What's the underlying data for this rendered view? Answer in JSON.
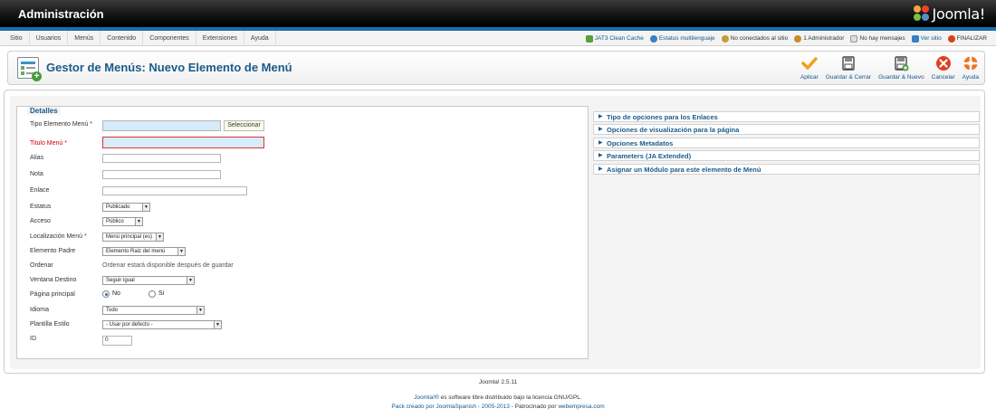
{
  "header": {
    "title": "Administración",
    "logo_text": "Joomla!"
  },
  "menubar": {
    "items": [
      "Sitio",
      "Usuarios",
      "Menús",
      "Contenido",
      "Componentes",
      "Extensiones",
      "Ayuda"
    ],
    "status": {
      "clean_cache": "JAT3 Clean Cache",
      "multilang": "Estatus multilenguaje",
      "site_visitors": "No conectados al sitio",
      "admins": "1 Administrador",
      "messages": "No hay mensajes",
      "view_site": "Ver sitio",
      "logout": "FINALIZAR"
    }
  },
  "toolbar": {
    "title": "Gestor de Menús: Nuevo Elemento de Menú",
    "buttons": {
      "apply": "Aplicar",
      "save_close": "Guardar & Cerrar",
      "save_new": "Guardar & Nuevo",
      "cancel": "Cancelar",
      "help": "Ayuda"
    }
  },
  "form": {
    "legend": "Detalles",
    "menu_type_label": "Tipo Elemento Menú",
    "select_button": "Seleccionar",
    "title_label": "Titulo Menú",
    "alias_label": "Alias",
    "note_label": "Nota",
    "link_label": "Enlace",
    "status_label": "Estatus",
    "status_value": "Publicado",
    "access_label": "Acceso",
    "access_value": "Público",
    "location_label": "Localización Menú",
    "location_value": "Menú principal (es)",
    "parent_label": "Elemento Padre",
    "parent_value": "Elemento Raiz del menú",
    "order_label": "Ordenar",
    "order_text": "Ordenar estará disponible después de guardar",
    "target_label": "Ventana Destino",
    "target_value": "Seguir igual",
    "home_label": "Página principal",
    "home_no": "No",
    "home_yes": "Si",
    "language_label": "Idioma",
    "language_value": "Todo",
    "template_label": "Plantilla Estilo",
    "template_value": "- Usar por defecto -",
    "id_label": "ID",
    "id_value": "0"
  },
  "accordion": [
    "Tipo de opciones para los Enlaces",
    "Opciones de visualización para la página",
    "Opciones Metadatos",
    "Parameters (JA Extended)",
    "Asignar un Módulo para este elemento de Menú"
  ],
  "footer": {
    "version": "Joomla! 2.5.11",
    "license_link": "Joomla!®",
    "license_text": " es software libre distribuido bajo la licencia GNU/GPL.",
    "pack_link": "Pack creado por JoomlaSpanish - 2005-2013",
    "sponsor_text": " - Patrocinado por ",
    "sponsor_link": "webempresa.com"
  },
  "colors": {
    "accent": "#1b6fa8",
    "title": "#1a5b8a",
    "required": "#cc0000"
  }
}
